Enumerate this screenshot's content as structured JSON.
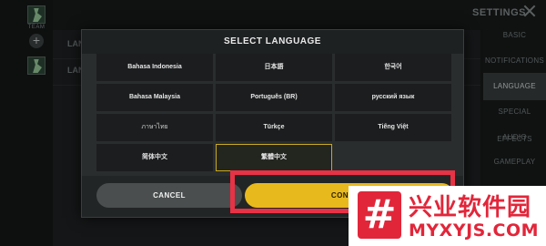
{
  "background": {
    "team_label": "TEAM",
    "plus": "+",
    "rows": [
      "LANGU",
      "LANGU"
    ],
    "settings_title": "SETTINGS",
    "menu": [
      {
        "label": "BASIC",
        "active": false
      },
      {
        "label": "NOTIFICATIONS",
        "active": false
      },
      {
        "label": "LANGUAGE",
        "active": true
      },
      {
        "label": "SPECIAL EFFECTS",
        "active": false
      },
      {
        "label": "AUDIO",
        "active": false
      },
      {
        "label": "GAMEPLAY",
        "active": false
      }
    ]
  },
  "modal": {
    "title": "SELECT LANGUAGE",
    "languages": [
      {
        "label": "Bahasa Indonesia",
        "selected": false
      },
      {
        "label": "日本語",
        "selected": false
      },
      {
        "label": "한국어",
        "selected": false
      },
      {
        "label": "Bahasa Malaysia",
        "selected": false
      },
      {
        "label": "Português (BR)",
        "selected": false
      },
      {
        "label": "русский язык",
        "selected": false
      },
      {
        "label": "ภาษาไทย",
        "selected": false
      },
      {
        "label": "Türkçe",
        "selected": false
      },
      {
        "label": "Tiếng Việt",
        "selected": false
      },
      {
        "label": "简体中文",
        "selected": false
      },
      {
        "label": "繁體中文",
        "selected": true
      }
    ],
    "cancel_label": "CANCEL",
    "confirm_label": "CONFIRM"
  },
  "watermark": {
    "symbol": "#",
    "chinese": "兴业软件园",
    "domain": "MYXYJS.COM"
  },
  "colors": {
    "accent": "#e8b91d",
    "selected_border": "#c9a922",
    "highlight": "#e83245",
    "watermark": "#e2263a"
  }
}
